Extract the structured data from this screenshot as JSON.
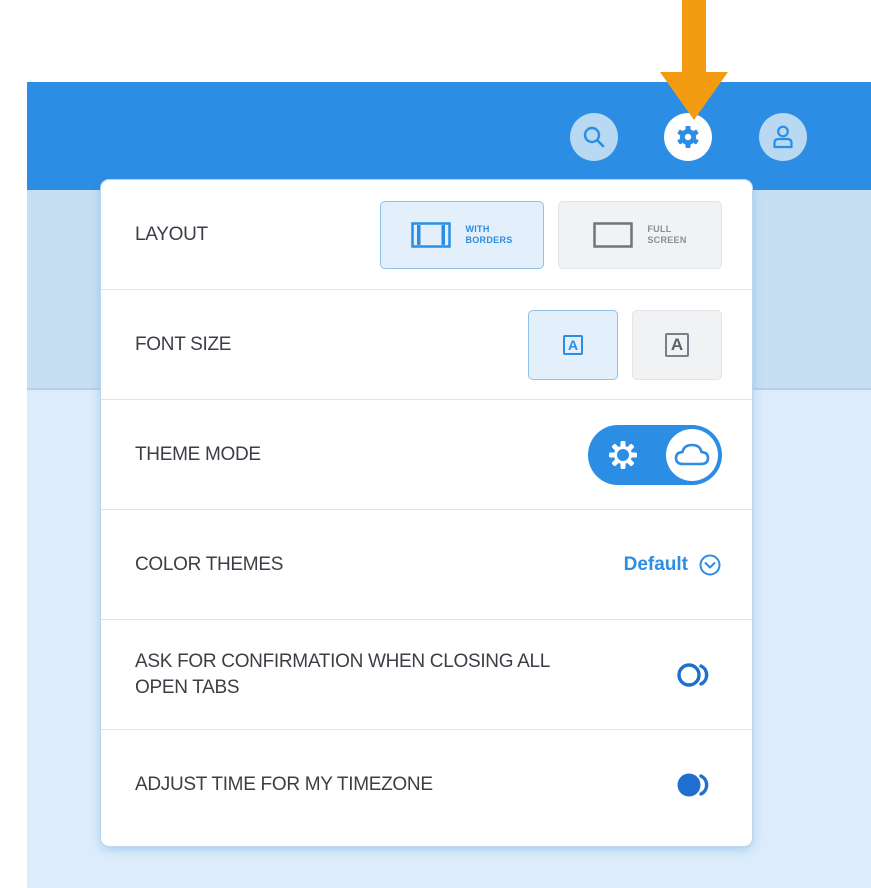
{
  "header": {
    "icons": [
      "search-icon",
      "gear-icon",
      "user-icon"
    ]
  },
  "annotation": {
    "arrow_color": "#f39c12"
  },
  "accent_color": "#2b8de3",
  "settings": {
    "layout": {
      "label": "LAYOUT",
      "options": [
        {
          "line1": "WITH",
          "line2": "BORDERS",
          "selected": true
        },
        {
          "line1": "FULL",
          "line2": "SCREEN",
          "selected": false
        }
      ]
    },
    "font_size": {
      "label": "FONT SIZE",
      "options": [
        {
          "glyph": "A",
          "selected": true
        },
        {
          "glyph": "A",
          "selected": false
        }
      ]
    },
    "theme_mode": {
      "label": "THEME MODE",
      "value": "light"
    },
    "color_themes": {
      "label": "COLOR THEMES",
      "value": "Default"
    },
    "confirm_close": {
      "label": "ASK FOR CONFIRMATION WHEN CLOSING ALL OPEN TABS",
      "enabled": false
    },
    "adjust_timezone": {
      "label": "ADJUST TIME FOR MY TIMEZONE",
      "enabled": true
    }
  }
}
